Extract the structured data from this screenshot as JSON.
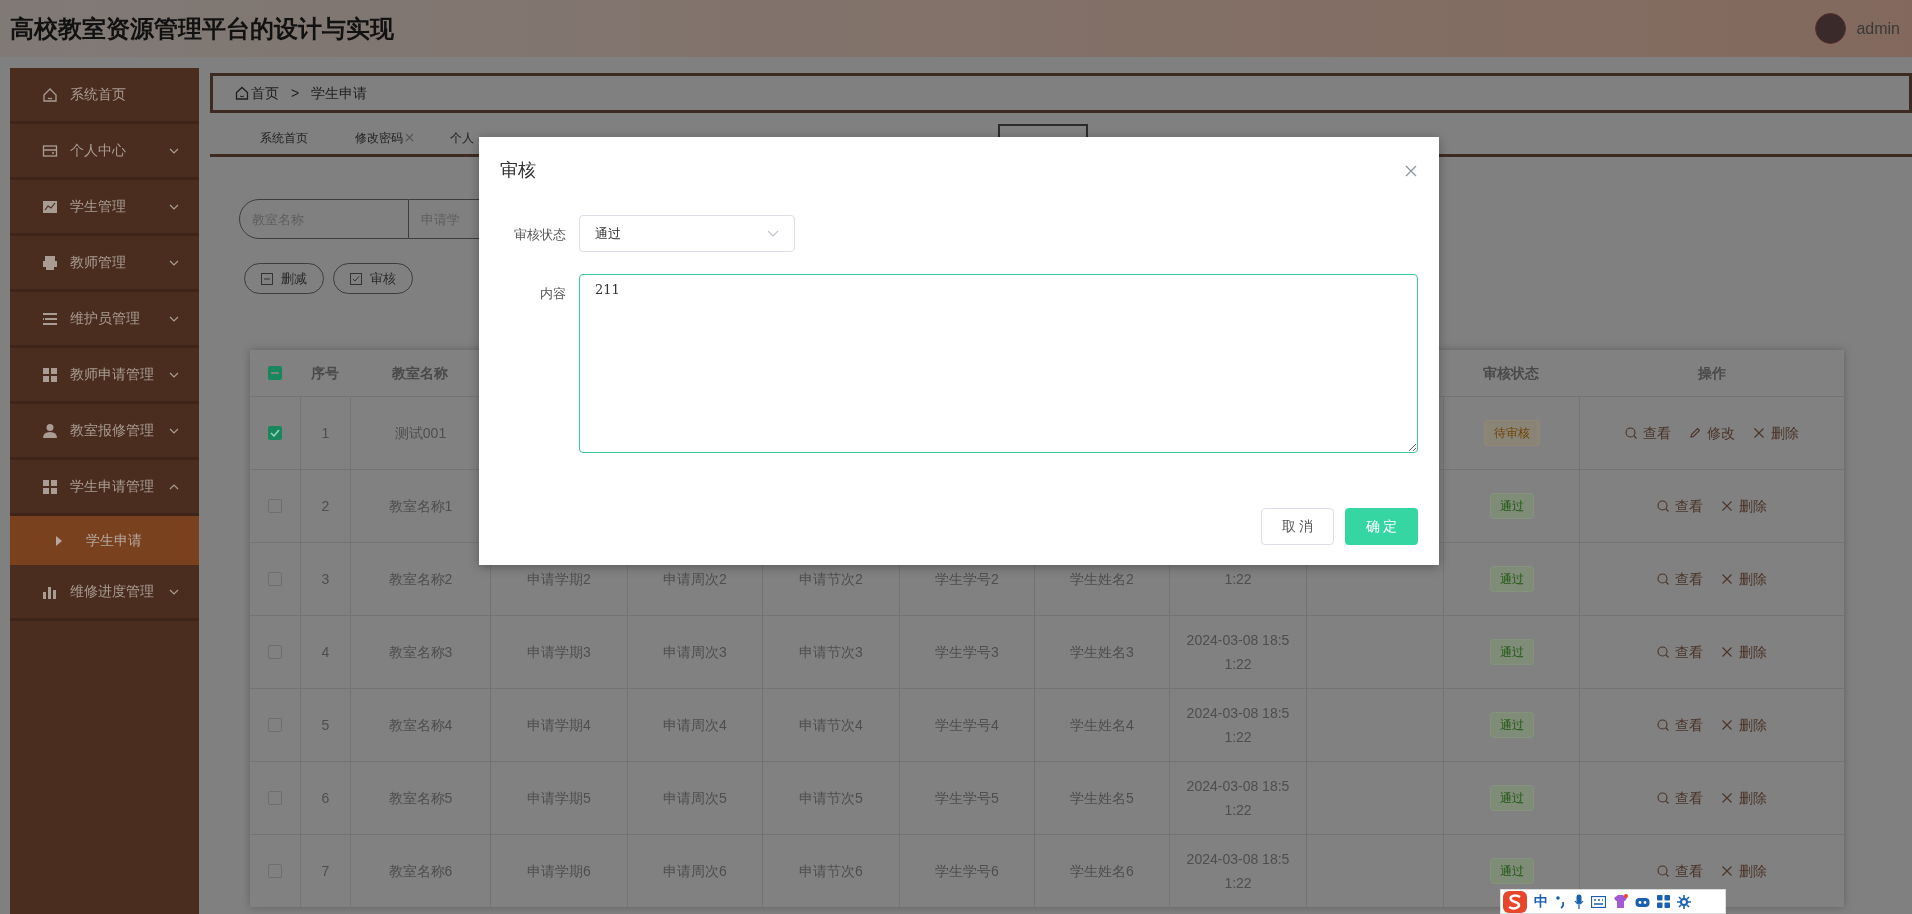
{
  "header": {
    "title": "高校教室资源管理平台的设计与实现",
    "user": "admin"
  },
  "sidebar": {
    "items": [
      {
        "label": "系统首页",
        "kind": "link"
      },
      {
        "label": "个人中心",
        "kind": "menu",
        "expanded": false
      },
      {
        "label": "学生管理",
        "kind": "menu",
        "expanded": false
      },
      {
        "label": "教师管理",
        "kind": "menu",
        "expanded": false
      },
      {
        "label": "维护员管理",
        "kind": "menu",
        "expanded": false
      },
      {
        "label": "教师申请管理",
        "kind": "menu",
        "expanded": false
      },
      {
        "label": "教室报修管理",
        "kind": "menu",
        "expanded": false
      },
      {
        "label": "学生申请管理",
        "kind": "menu",
        "expanded": true,
        "children": [
          {
            "label": "学生申请",
            "selected": true
          }
        ]
      },
      {
        "label": "维修进度管理",
        "kind": "menu",
        "expanded": false
      }
    ]
  },
  "breadcrumb": {
    "items": [
      "首页",
      "学生申请"
    ],
    "separator": ">"
  },
  "tabs": [
    {
      "label": "系统首页",
      "closable": false,
      "selected": false
    },
    {
      "label": "修改密码",
      "closable": true,
      "selected": false
    },
    {
      "label": "个人",
      "closable": false,
      "selected": false
    },
    {
      "selected": true
    }
  ],
  "search": {
    "fields": [
      {
        "placeholder": "教室名称"
      },
      {
        "placeholder": "申请学"
      }
    ]
  },
  "actions": [
    {
      "label": "删减",
      "kind": "delete"
    },
    {
      "label": "审核",
      "kind": "review"
    }
  ],
  "table": {
    "header_indeterminate": true,
    "columns": [
      {
        "label": "序号"
      },
      {
        "label": "教室名称"
      },
      {},
      {},
      {},
      {},
      {},
      {},
      {},
      {
        "label": "审核状态"
      },
      {
        "label": "操作"
      }
    ],
    "rows": [
      {
        "checked": true,
        "cells": [
          "1",
          "测试001"
        ],
        "status": "待审核",
        "pending": true,
        "actions": [
          {
            "label": "查看",
            "kind": "view"
          },
          {
            "label": "修改",
            "kind": "edit"
          },
          {
            "label": "删除",
            "kind": "delete"
          }
        ]
      },
      {
        "checked": false,
        "cells": [
          "2",
          "教室名称1"
        ],
        "status": "通过",
        "pending": false,
        "actions": [
          {
            "label": "查看",
            "kind": "view"
          },
          {
            "label": "删除",
            "kind": "delete"
          }
        ]
      },
      {
        "checked": false,
        "cells": [
          "3",
          "教室名称2",
          "申请学期2",
          "申请周次2",
          "申请节次2",
          "学生学号2",
          "学生姓名2",
          "1:22"
        ],
        "status": "通过",
        "pending": false,
        "actions": [
          {
            "label": "查看",
            "kind": "view"
          },
          {
            "label": "删除",
            "kind": "delete"
          }
        ]
      },
      {
        "checked": false,
        "cells": [
          "4",
          "教室名称3",
          "申请学期3",
          "申请周次3",
          "申请节次3",
          "学生学号3",
          "学生姓名3",
          "2024-03-08 18:51:22"
        ],
        "status": "通过",
        "pending": false,
        "actions": [
          {
            "label": "查看",
            "kind": "view"
          },
          {
            "label": "删除",
            "kind": "delete"
          }
        ]
      },
      {
        "checked": false,
        "cells": [
          "5",
          "教室名称4",
          "申请学期4",
          "申请周次4",
          "申请节次4",
          "学生学号4",
          "学生姓名4",
          "2024-03-08 18:51:22"
        ],
        "status": "通过",
        "pending": false,
        "actions": [
          {
            "label": "查看",
            "kind": "view"
          },
          {
            "label": "删除",
            "kind": "delete"
          }
        ]
      },
      {
        "checked": false,
        "cells": [
          "6",
          "教室名称5",
          "申请学期5",
          "申请周次5",
          "申请节次5",
          "学生学号5",
          "学生姓名5",
          "2024-03-08 18:51:22"
        ],
        "status": "通过",
        "pending": false,
        "actions": [
          {
            "label": "查看",
            "kind": "view"
          },
          {
            "label": "删除",
            "kind": "delete"
          }
        ]
      },
      {
        "checked": false,
        "cells": [
          "7",
          "教室名称6",
          "申请学期6",
          "申请周次6",
          "申请节次6",
          "学生学号6",
          "学生姓名6",
          "2024-03-08 18:51:22"
        ],
        "status": "通过",
        "pending": false,
        "actions": [
          {
            "label": "查看",
            "kind": "view"
          },
          {
            "label": "删除",
            "kind": "delete"
          }
        ]
      }
    ]
  },
  "modal": {
    "title": "审核",
    "fields": [
      {
        "label": "审核状态",
        "kind": "select",
        "value": "通过"
      },
      {
        "label": "内容",
        "kind": "textarea",
        "value": "211"
      }
    ],
    "buttons": [
      {
        "label": "取 消",
        "kind": "default"
      },
      {
        "label": "确 定",
        "kind": "primary"
      }
    ]
  },
  "ime_bar": {
    "mode": "中"
  }
}
